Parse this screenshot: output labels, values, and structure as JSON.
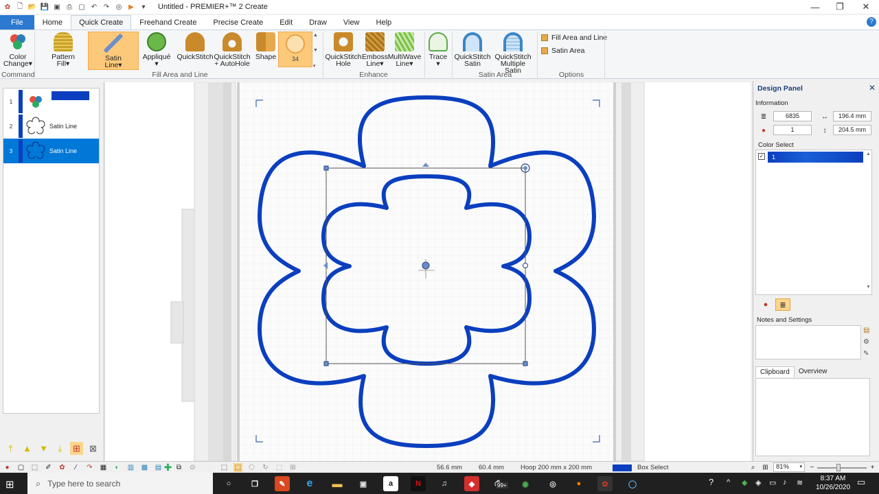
{
  "titlebar": {
    "title": "Untitled - PREMIER+™ 2 Create",
    "minimize": "—",
    "restore": "❐",
    "close": "✕"
  },
  "tabs": [
    "File",
    "Home",
    "Quick Create",
    "Freehand Create",
    "Precise Create",
    "Edit",
    "Draw",
    "View",
    "Help"
  ],
  "ribbon": {
    "buttons": [
      {
        "label": "Color\nChange▾",
        "icon": "color-change-icon"
      },
      {
        "label": "Pattern\nFill▾",
        "icon": "pattern-fill-icon"
      },
      {
        "label": "Satin\nLine▾",
        "icon": "satin-line-icon"
      },
      {
        "label": "Appliqué\n▾",
        "icon": "applique-icon"
      },
      {
        "label": "QuickStitch",
        "icon": "quickstitch-icon"
      },
      {
        "label": "QuickStitch\n+ AutoHole",
        "icon": "quickstitch-autohole-icon"
      },
      {
        "label": "Shape",
        "icon": "shape-icon"
      },
      {
        "label": "34",
        "icon": "shape-gallery-icon"
      },
      {
        "label": "QuickStitch\nHole",
        "icon": "quickstitch-hole-icon"
      },
      {
        "label": "Emboss\nLine▾",
        "icon": "emboss-line-icon"
      },
      {
        "label": "MultiWave\nLine▾",
        "icon": "multiwave-line-icon"
      },
      {
        "label": "Trace\n▾",
        "icon": "trace-icon"
      },
      {
        "label": "QuickStitch\nSatin",
        "icon": "quickstitch-satin-icon"
      },
      {
        "label": "QuickStitch\nMultiple Satin",
        "icon": "quickstitch-multiple-satin-icon"
      }
    ],
    "options": [
      "Fill Area and Line",
      "Satin Area"
    ],
    "groups": [
      "Command",
      "Fill Area and Line",
      "Enhance",
      "Satin Area",
      "Options"
    ]
  },
  "layers": [
    {
      "num": "1",
      "label": ""
    },
    {
      "num": "2",
      "label": "Satin Line"
    },
    {
      "num": "3",
      "label": "Satin Line"
    }
  ],
  "design_panel": {
    "title": "Design Panel",
    "information_label": "Information",
    "stitches": "6835",
    "width": "196.4 mm",
    "colors": "1",
    "height": "204.5 mm",
    "color_select_label": "Color Select",
    "color_item": "1",
    "notes_label": "Notes and Settings",
    "tabs": [
      "Clipboard",
      "Overview"
    ]
  },
  "status": {
    "width": "56.6 mm",
    "height": "60.4 mm",
    "hoop": "Hoop 200 mm x 200 mm",
    "mode": "Box Select",
    "zoom": "81%"
  },
  "taskbar": {
    "search_placeholder": "Type here to search",
    "time": "8:37 AM",
    "date": "10/26/2020",
    "badge": "99+"
  },
  "colors": {
    "accent": "#2b79d0",
    "thread": "#0b3fbf",
    "selected_tab": "#fcc97a"
  }
}
